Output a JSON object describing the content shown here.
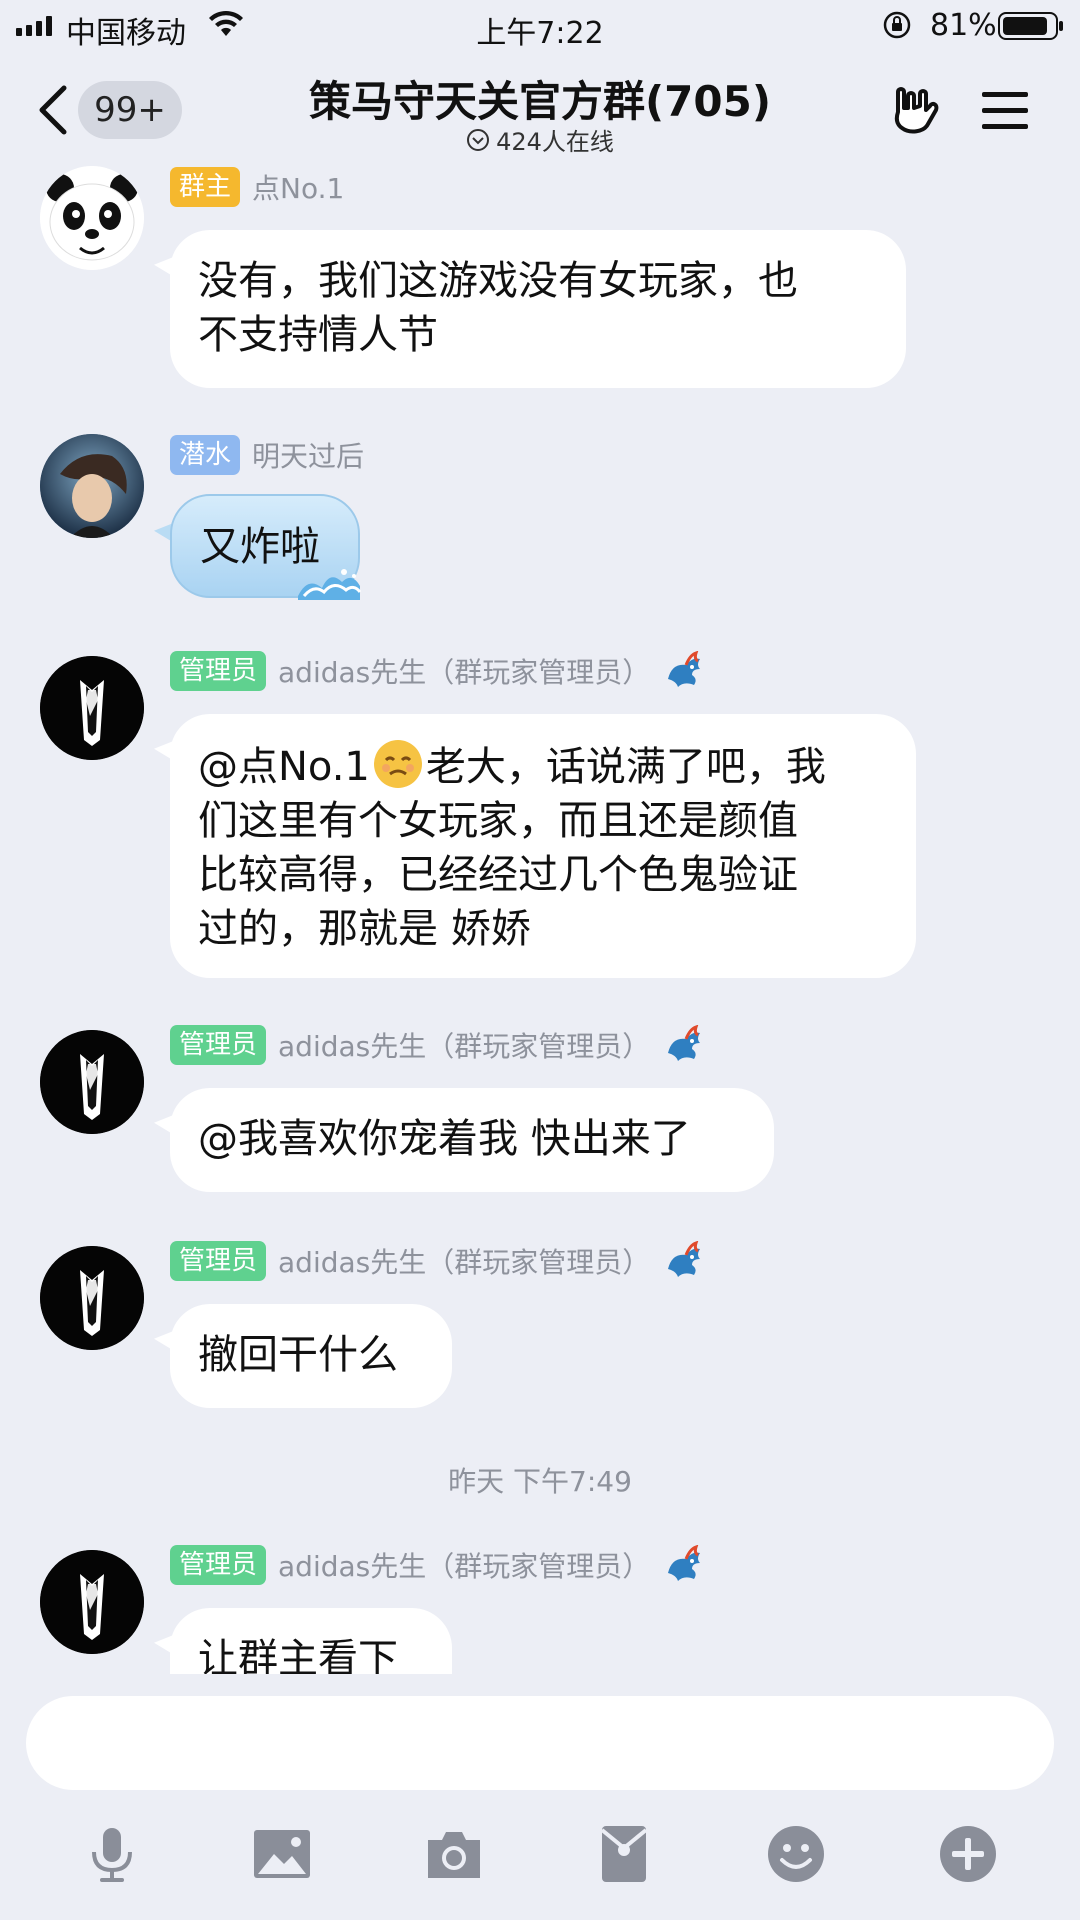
{
  "status_bar": {
    "carrier": "中国移动",
    "time": "上午7:22",
    "battery": "81%"
  },
  "header": {
    "back_badge": "99+",
    "title": "策马守天关官方群(705)",
    "online": "424人在线"
  },
  "messages": [
    {
      "badge": "群主",
      "badge_color": "#f5b82e",
      "sender": "点No.1",
      "text": "没有，我们这游戏没有女玩家，也\n不支持情人节",
      "avatar": "panda-avatar"
    },
    {
      "badge": "潜水",
      "badge_color": "#8fb8f0",
      "sender": "明天过后",
      "text": "又炸啦",
      "avatar": "anime-avatar"
    },
    {
      "badge": "管理员",
      "badge_color": "#5fd18f",
      "sender": "adidas先生（群玩家管理员）",
      "text_before_emoji": "@点No.1",
      "text_after_emoji": "老大，话说满了吧，我\n们这里有个女玩家，而且还是颜值\n比较高得，已经经过几个色鬼验证\n过的，那就是 娇娇",
      "avatar": "suit-avatar"
    },
    {
      "badge": "管理员",
      "badge_color": "#5fd18f",
      "sender": "adidas先生（群玩家管理员）",
      "text": "@我喜欢你宠着我 快出来了",
      "avatar": "suit-avatar"
    },
    {
      "badge": "管理员",
      "badge_color": "#5fd18f",
      "sender": "adidas先生（群玩家管理员）",
      "text": "撤回干什么",
      "avatar": "suit-avatar"
    },
    {
      "badge": "管理员",
      "badge_color": "#5fd18f",
      "sender": "adidas先生（群玩家管理员）",
      "text": "让群主看下",
      "avatar": "suit-avatar"
    }
  ],
  "time_separator": "昨天 下午7:49",
  "toolbar": [
    "microphone-icon",
    "image-icon",
    "camera-icon",
    "red-packet-icon",
    "emoji-icon",
    "plus-icon"
  ],
  "colors": {
    "background": "#eceef5",
    "bubble": "#ffffff",
    "toolbar_icon": "#8a8e99"
  }
}
